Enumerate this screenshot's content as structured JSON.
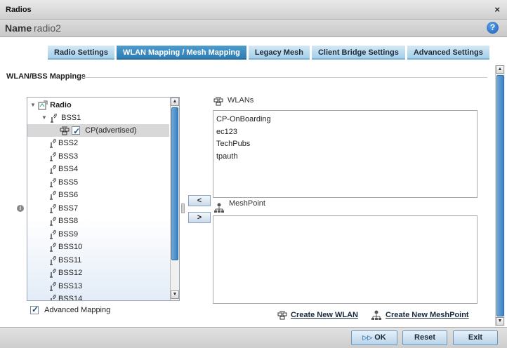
{
  "window": {
    "title": "Radios",
    "close_glyph": "×"
  },
  "name_bar": {
    "label": "Name",
    "value": "radio2",
    "help_glyph": "?"
  },
  "tabs": [
    {
      "label": "Radio Settings"
    },
    {
      "label": "WLAN Mapping / Mesh Mapping",
      "active": true
    },
    {
      "label": "Legacy Mesh"
    },
    {
      "label": "Client Bridge Settings"
    },
    {
      "label": "Advanced Settings"
    }
  ],
  "section": {
    "title": "WLAN/BSS Mappings"
  },
  "tree": {
    "root": "Radio",
    "bss1": "BSS1",
    "wlan_item": "CP(advertised)",
    "bss_items": [
      "BSS2",
      "BSS3",
      "BSS4",
      "BSS5",
      "BSS6",
      "BSS7",
      "BSS8",
      "BSS9",
      "BSS10",
      "BSS11",
      "BSS12",
      "BSS13",
      "BSS14"
    ]
  },
  "advanced_mapping": {
    "label": "Advanced Mapping",
    "checked": true
  },
  "move_buttons": {
    "left": "<",
    "right": ">"
  },
  "wlans": {
    "label": "WLANs",
    "items": [
      "CP-OnBoarding",
      "ec123",
      "TechPubs",
      "tpauth"
    ]
  },
  "meshpoint": {
    "label": "MeshPoint"
  },
  "links": {
    "create_wlan": "Create New WLAN",
    "create_meshpoint": "Create New MeshPoint"
  },
  "footer": {
    "ok": "OK",
    "reset": "Reset",
    "exit": "Exit"
  },
  "colors": {
    "active_tab": "#2f7db3",
    "tab": "#a6cfe9",
    "scroll_thumb": "#3d82c4"
  }
}
